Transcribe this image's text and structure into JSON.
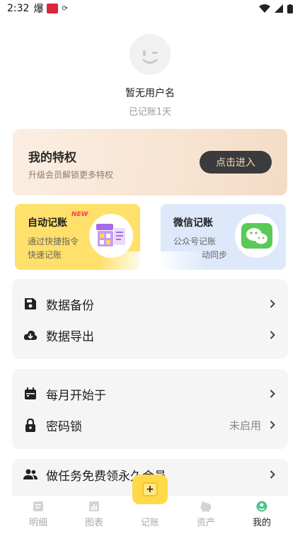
{
  "status_bar": {
    "time": "2:32",
    "app_glyph": "爆"
  },
  "profile": {
    "username": "暂无用户名",
    "days": "已记账1天"
  },
  "vip": {
    "title": "我的特权",
    "subtitle": "升级会员解锁更多特权",
    "button": "点击进入"
  },
  "feature_cards": {
    "auto": {
      "title": "自动记账",
      "badge": "NEW",
      "line1": "通过快捷指令",
      "line2": "快速记账"
    },
    "wechat": {
      "title": "微信记账",
      "line1": "公众号记账",
      "line2": "动同步"
    }
  },
  "group_data": {
    "backup": "数据备份",
    "export": "数据导出"
  },
  "group_settings": {
    "month_start": "每月开始于",
    "password": "密码锁",
    "password_value": "未启用"
  },
  "group_task": {
    "task": "做任务免费领永久会员"
  },
  "tabbar": {
    "details": "明细",
    "charts": "图表",
    "add": "记账",
    "assets": "资产",
    "mine": "我的"
  },
  "colors": {
    "accent_yellow": "#ffd94a",
    "vip_button": "#3b3b3d",
    "wechat_green": "#5ac958"
  }
}
